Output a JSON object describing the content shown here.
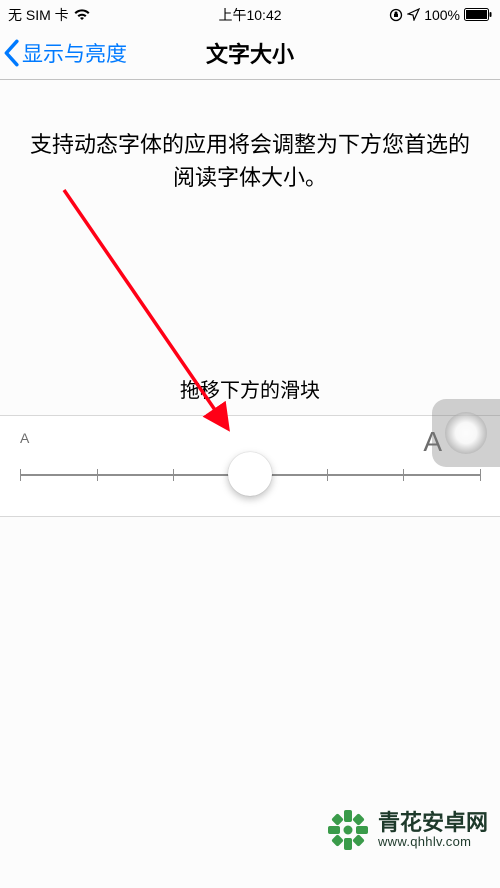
{
  "status": {
    "carrier": "无 SIM 卡",
    "time": "上午10:42",
    "battery_pct": "100%"
  },
  "nav": {
    "back_label": "显示与亮度",
    "title": "文字大小"
  },
  "description": "支持动态字体的应用将会调整为下方您首选的阅读字体大小。",
  "instruction": "拖移下方的滑块",
  "slider": {
    "min_label": "A",
    "max_label": "A",
    "steps": 7,
    "value_index": 3
  },
  "watermark": {
    "title": "青花安卓网",
    "url": "www.qhhlv.com"
  }
}
